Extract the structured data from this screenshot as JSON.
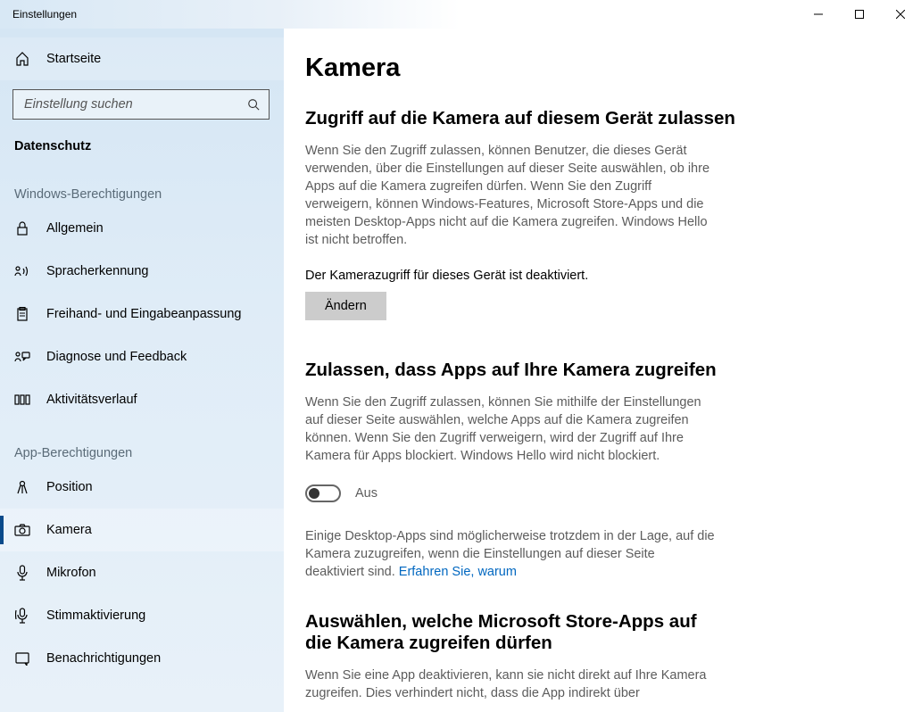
{
  "window": {
    "title": "Einstellungen"
  },
  "sidebar": {
    "home": "Startseite",
    "search_placeholder": "Einstellung suchen",
    "category": "Datenschutz",
    "group1_label": "Windows-Berechtigungen",
    "group1": [
      {
        "label": "Allgemein"
      },
      {
        "label": "Spracherkennung"
      },
      {
        "label": "Freihand- und Eingabeanpassung"
      },
      {
        "label": "Diagnose und Feedback"
      },
      {
        "label": "Aktivitätsverlauf"
      }
    ],
    "group2_label": "App-Berechtigungen",
    "group2": [
      {
        "label": "Position"
      },
      {
        "label": "Kamera"
      },
      {
        "label": "Mikrofon"
      },
      {
        "label": "Stimmaktivierung"
      },
      {
        "label": "Benachrichtigungen"
      }
    ]
  },
  "main": {
    "title": "Kamera",
    "s1": {
      "heading": "Zugriff auf die Kamera auf diesem Gerät zulassen",
      "text": "Wenn Sie den Zugriff zulassen, können Benutzer, die dieses Gerät verwenden, über die Einstellungen auf dieser Seite auswählen, ob ihre Apps auf die Kamera zugreifen dürfen. Wenn Sie den Zugriff verweigern, können Windows-Features, Microsoft Store-Apps und die meisten Desktop-Apps nicht auf die Kamera zugreifen. Windows Hello ist nicht betroffen.",
      "status": "Der Kamerazugriff für dieses Gerät ist deaktiviert.",
      "button": "Ändern"
    },
    "s2": {
      "heading": "Zulassen, dass Apps auf Ihre Kamera zugreifen",
      "text": "Wenn Sie den Zugriff zulassen, können Sie mithilfe der Einstellungen auf dieser Seite auswählen, welche Apps auf die Kamera zugreifen können. Wenn Sie den Zugriff verweigern, wird der Zugriff auf Ihre Kamera für Apps blockiert. Windows Hello wird nicht blockiert.",
      "toggle_label": "Aus",
      "note_before": "Einige Desktop-Apps sind möglicherweise trotzdem in der Lage, auf die Kamera zuzugreifen, wenn die Einstellungen auf dieser Seite deaktiviert sind. ",
      "link": "Erfahren Sie, warum"
    },
    "s3": {
      "heading": "Auswählen, welche Microsoft Store-Apps auf die Kamera zugreifen dürfen",
      "text": "Wenn Sie eine App deaktivieren, kann sie nicht direkt auf Ihre Kamera zugreifen. Dies verhindert nicht, dass die App indirekt über"
    }
  }
}
